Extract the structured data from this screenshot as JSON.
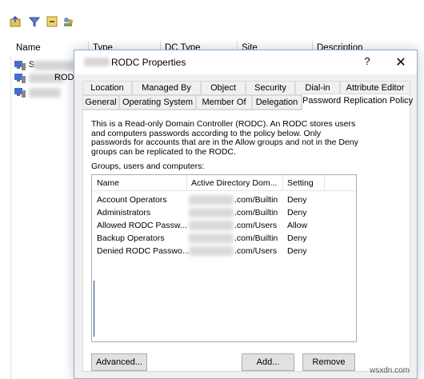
{
  "background_window": {
    "columns": [
      "Name",
      "Type",
      "DC Type",
      "Site",
      "Description"
    ],
    "row1_fragment": "S",
    "row2_fragment": "ROD"
  },
  "dialog": {
    "title": "RODC Properties",
    "help_symbol": "?",
    "close_symbol": "✕",
    "tabs_row1": [
      "Location",
      "Managed By",
      "Object",
      "Security",
      "Dial-in",
      "Attribute Editor"
    ],
    "tabs_row2": [
      "General",
      "Operating System",
      "Member Of",
      "Delegation",
      "Password Replication Policy"
    ],
    "active_tab": "Password Replication Policy",
    "description": "This is a Read-only Domain Controller (RODC).  An RODC stores users and computers passwords according to the policy below.  Only passwords for accounts that are in the Allow groups and not in the Deny groups can be replicated to the RODC.",
    "groups_label": "Groups, users and computers:",
    "list": {
      "headers": [
        "Name",
        "Active Directory Dom...",
        "Setting"
      ],
      "rows": [
        {
          "name": "Account Operators",
          "domain": ".com/Builtin",
          "setting": "Deny"
        },
        {
          "name": "Administrators",
          "domain": ".com/Builtin",
          "setting": "Deny"
        },
        {
          "name": "Allowed RODC Passw...",
          "domain": ".com/Users",
          "setting": "Allow"
        },
        {
          "name": "Backup Operators",
          "domain": ".com/Builtin",
          "setting": "Deny"
        },
        {
          "name": "Denied RODC Passwo...",
          "domain": ".com/Users",
          "setting": "Deny"
        }
      ]
    },
    "buttons": {
      "advanced": "Advanced...",
      "add": "Add...",
      "remove": "Remove"
    }
  },
  "watermark": "wsxdn.com",
  "colors": {
    "accent_border": "#8fb0d0",
    "dialog_bg": "#f0f0f0"
  }
}
